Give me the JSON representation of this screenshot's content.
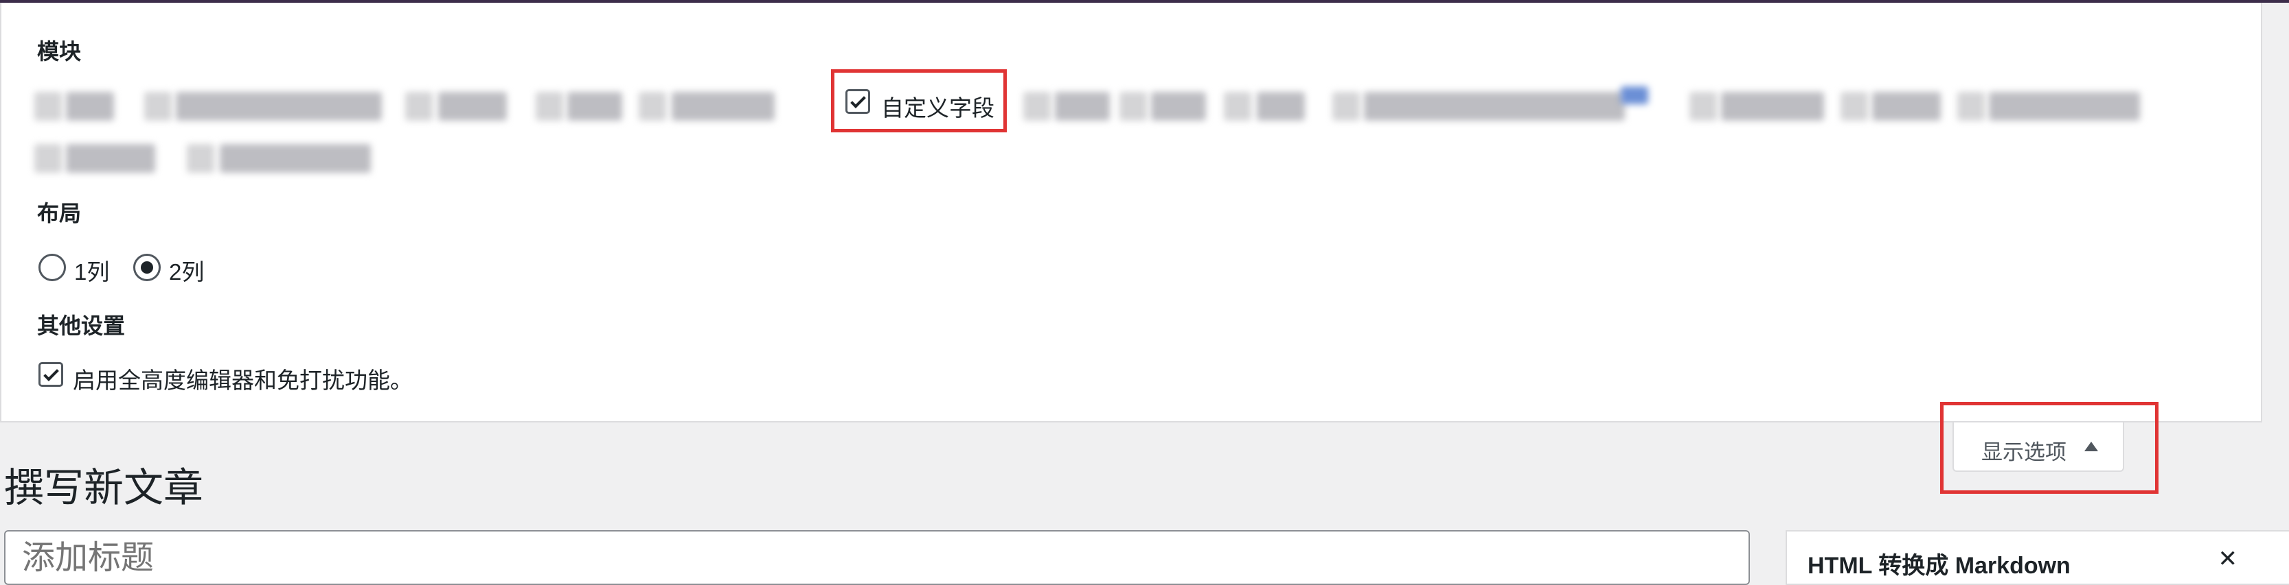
{
  "screen_options": {
    "modules_title": "模块",
    "custom_fields_label": "自定义字段",
    "custom_fields_checked": true,
    "layout_title": "布局",
    "layout_options": [
      {
        "label": "1列",
        "selected": false
      },
      {
        "label": "2列",
        "selected": true
      }
    ],
    "other_title": "其他设置",
    "fullheight_label": "启用全高度编辑器和免打扰功能。",
    "fullheight_checked": true
  },
  "toggle": {
    "label": "显示选项"
  },
  "editor": {
    "page_title": "撰写新文章",
    "title_placeholder": "添加标题"
  },
  "sidebar": {
    "box_title": "HTML 转换成 Markdown",
    "box_control": "✕"
  },
  "colors": {
    "highlight": "#e03434",
    "panel_border": "#dcdcde",
    "background": "#f0f0f1"
  }
}
